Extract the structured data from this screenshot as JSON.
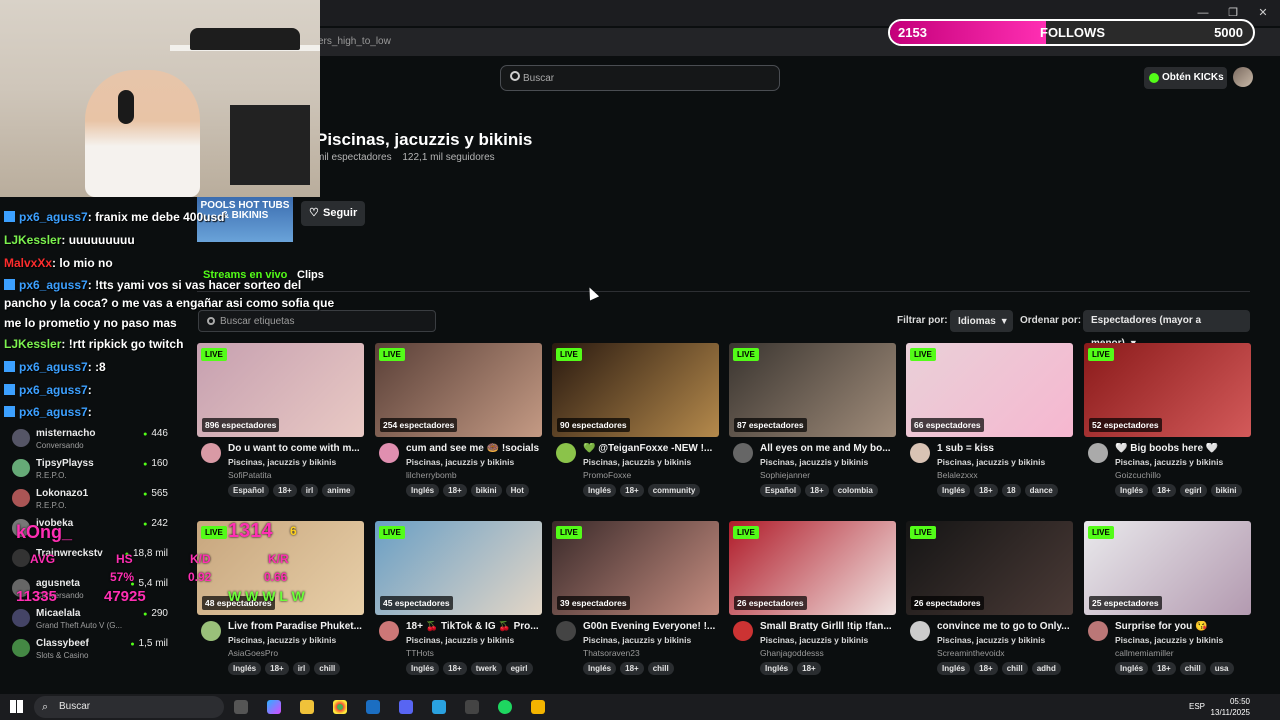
{
  "browser": {
    "url_fragment": "ers_high_to_low",
    "min_glyph": "—",
    "max_glyph": "❐",
    "close_glyph": "✕"
  },
  "overlay_follows": {
    "current": "2153",
    "label": "FOLLOWS",
    "goal": "5000",
    "progress": 0.43
  },
  "header": {
    "search_placeholder": "Buscar",
    "kicks_label": "Obtén KICKs"
  },
  "category": {
    "title": "Piscinas, jacuzzis y bikinis",
    "viewers": "mil espectadores",
    "followers": "122,1 mil seguidores",
    "thumb_text": "POOLS HOT TUBS & BIKINIS",
    "follow_label": "Seguir"
  },
  "tabs": {
    "live": "Streams en vivo",
    "clips": "Clips"
  },
  "filters": {
    "tag_search_placeholder": "Buscar etiquetas",
    "filter_label": "Filtrar por:",
    "language": "Idiomas",
    "sort_label": "Ordenar por:",
    "sort_value": "Espectadores (mayor a menor)"
  },
  "live_badge": "LIVE",
  "streams": [
    {
      "viewers": "896 espectadores",
      "title": "Do u want to come with m...",
      "category": "Piscinas, jacuzzis y bikinis",
      "user": "SofiPatatita",
      "tags": [
        "Español",
        "18+",
        "irl",
        "anime"
      ],
      "colors": [
        "#c6a0b0",
        "#e9c9c4"
      ],
      "avatar": "#d99aa5"
    },
    {
      "viewers": "254 espectadores",
      "title": "cum and see me 🍩 !socials",
      "category": "Piscinas, jacuzzis y bikinis",
      "user": "lilcherrybomb",
      "tags": [
        "Inglés",
        "18+",
        "bikini",
        "Hot"
      ],
      "colors": [
        "#5a4038",
        "#c49a84"
      ],
      "avatar": "#e08fb0"
    },
    {
      "viewers": "90 espectadores",
      "title": "💚 @TeiganFoxxe -NEW !...",
      "category": "Piscinas, jacuzzis y bikinis",
      "user": "PromoFoxxe",
      "tags": [
        "Inglés",
        "18+",
        "community"
      ],
      "colors": [
        "#2a1a10",
        "#b58a4c"
      ],
      "avatar": "#8bc34a"
    },
    {
      "viewers": "87 espectadores",
      "title": "All eyes on me and My bo...",
      "category": "Piscinas, jacuzzis y bikinis",
      "user": "Sophiejanner",
      "tags": [
        "Español",
        "18+",
        "colombia"
      ],
      "colors": [
        "#3a3530",
        "#a08c7a"
      ],
      "avatar": "#666"
    },
    {
      "viewers": "66 espectadores",
      "title": "1 sub = kiss",
      "category": "Piscinas, jacuzzis y bikinis",
      "user": "Belalezxxx",
      "tags": [
        "Inglés",
        "18+",
        "18",
        "dance"
      ],
      "colors": [
        "#e9d0d8",
        "#f6b7d0"
      ],
      "avatar": "#d9c3b4"
    },
    {
      "viewers": "52 espectadores",
      "title": "🤍 Big boobs here 🤍",
      "category": "Piscinas, jacuzzis y bikinis",
      "user": "Goizcuchillo",
      "tags": [
        "Inglés",
        "18+",
        "egirl",
        "bikini"
      ],
      "colors": [
        "#8a1a1a",
        "#d35a5a"
      ],
      "avatar": "#aaa"
    },
    {
      "viewers": "48 espectadores",
      "title": "Live from Paradise Phuket...",
      "category": "Piscinas, jacuzzis y bikinis",
      "user": "AsiaGoesPro",
      "tags": [
        "Inglés",
        "18+",
        "irl",
        "chill"
      ],
      "colors": [
        "#c7a67e",
        "#e8cfa8"
      ],
      "avatar": "#9ac07a"
    },
    {
      "viewers": "45 espectadores",
      "title": "18+ 🍒 TikTok & IG 🍒 Pro...",
      "category": "Piscinas, jacuzzis y bikinis",
      "user": "TTHots",
      "tags": [
        "Inglés",
        "18+",
        "twerk",
        "egirl"
      ],
      "colors": [
        "#6a9fc5",
        "#e3d6c6"
      ],
      "avatar": "#c77"
    },
    {
      "viewers": "39 espectadores",
      "title": "G00n Evening Everyone! !...",
      "category": "Piscinas, jacuzzis y bikinis",
      "user": "Thatsoraven23",
      "tags": [
        "Inglés",
        "18+",
        "chill"
      ],
      "colors": [
        "#3a2a2a",
        "#c58d80"
      ],
      "avatar": "#444"
    },
    {
      "viewers": "26 espectadores",
      "title": "Small Bratty Girlll !tip !fan...",
      "category": "Piscinas, jacuzzis y bikinis",
      "user": "Ghanjagoddesss",
      "tags": [
        "Inglés",
        "18+"
      ],
      "colors": [
        "#b01c2a",
        "#f1e4e2"
      ],
      "avatar": "#c33"
    },
    {
      "viewers": "26 espectadores",
      "title": "convince me to go to Only...",
      "category": "Piscinas, jacuzzis y bikinis",
      "user": "Screaminthevoidx",
      "tags": [
        "Inglés",
        "18+",
        "chill",
        "adhd"
      ],
      "colors": [
        "#151515",
        "#4a3a36"
      ],
      "avatar": "#ccc"
    },
    {
      "viewers": "25 espectadores",
      "title": "Surprise for you 😘",
      "category": "Piscinas, jacuzzis y bikinis",
      "user": "callmemiamiller",
      "tags": [
        "Inglés",
        "18+",
        "chill",
        "usa"
      ],
      "colors": [
        "#e9e9ec",
        "#b39ab0"
      ],
      "avatar": "#b77"
    }
  ],
  "sidebar": [
    {
      "name": "misternacho",
      "cat": "Conversando",
      "count": "446",
      "color": "#556"
    },
    {
      "name": "TipsyPlayss",
      "cat": "R.E.P.O.",
      "count": "160",
      "color": "#6a7"
    },
    {
      "name": "Lokonazo1",
      "cat": "R.E.P.O.",
      "count": "565",
      "color": "#a55"
    },
    {
      "name": "ivobeka",
      "cat": "",
      "count": "242",
      "color": "#777"
    },
    {
      "name": "Trainwreckstv",
      "cat": "",
      "count": "18,8 mil",
      "color": "#333"
    },
    {
      "name": "agusneta",
      "cat": "Conversando",
      "count": "5,4 mil",
      "color": "#666"
    },
    {
      "name": "Micaelala",
      "cat": "Grand Theft Auto V (G...",
      "count": "290",
      "color": "#446"
    },
    {
      "name": "Classybeef",
      "cat": "Slots & Casino",
      "count": "1,5 mil",
      "color": "#484"
    }
  ],
  "chat": [
    {
      "user": "px6_aguss7",
      "sep": ": ",
      "msg": "franix me debe 400usd",
      "cls": "u2",
      "icon": true
    },
    {
      "user": "LJKessler",
      "sep": ": ",
      "msg": "uuuuuuuuu",
      "cls": "u3",
      "icon": false
    },
    {
      "user": "MalvxXx",
      "sep": ": ",
      "msg": "lo mio no",
      "cls": "u4",
      "icon": false
    },
    {
      "user": "px6_aguss7",
      "sep": ": ",
      "msg": "!tts yami vos si vas hacer sorteo del",
      "cls": "u2",
      "icon": true
    },
    {
      "user": "",
      "sep": "",
      "msg": "pancho y la coca? o me vas a engañar asi como sofia que",
      "cls": "",
      "icon": false
    },
    {
      "user": "",
      "sep": "",
      "msg": "me lo prometio y no paso mas",
      "cls": "",
      "icon": false
    },
    {
      "user": "LJKessler",
      "sep": ": ",
      "msg": "!rtt ripkick go twitch",
      "cls": "u3",
      "icon": false
    },
    {
      "user": "px6_aguss7",
      "sep": ": ",
      "msg": ":8",
      "cls": "u2",
      "icon": true
    },
    {
      "user": "px6_aguss7",
      "sep": ": ",
      "msg": "",
      "cls": "u2",
      "icon": true
    },
    {
      "user": "px6_aguss7",
      "sep": ": ",
      "msg": "",
      "cls": "u2",
      "icon": true
    }
  ],
  "hud": {
    "name": "kOng_",
    "rank": "1314",
    "avg_label": "AVG",
    "hs_label": "HS",
    "avg": "0.92",
    "hs": "57%",
    "kd_label": "K/D",
    "kr_label": "K/R",
    "kr": "0.66",
    "elo": "11335",
    "elo2": "47925",
    "results": "W W W L W",
    "level": "6"
  },
  "taskbar": {
    "search": "Buscar",
    "lang": "ESP",
    "time": "05:50",
    "date": "13/11/2025"
  }
}
